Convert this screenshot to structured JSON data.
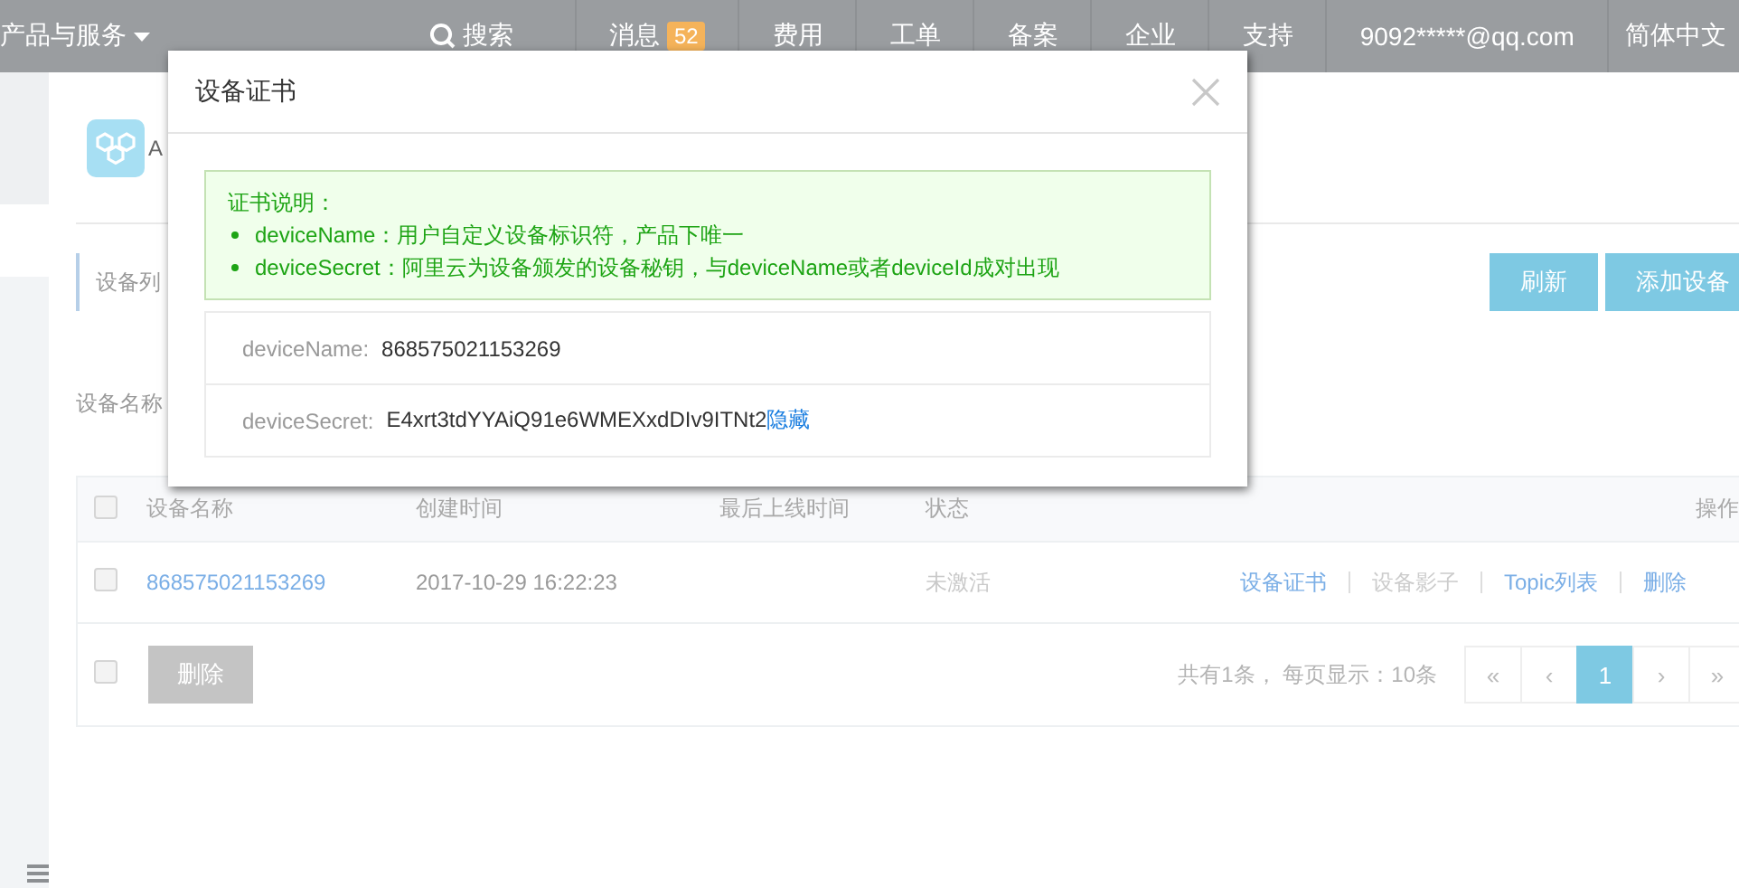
{
  "top_bar": {
    "menu": "产品与服务",
    "items": [
      {
        "kind": "search",
        "label": "搜索"
      },
      {
        "kind": "badge",
        "label": "消息",
        "badge": "52"
      },
      {
        "kind": "link",
        "label": "费用"
      },
      {
        "kind": "link",
        "label": "工单"
      },
      {
        "kind": "link",
        "label": "备案"
      },
      {
        "kind": "link",
        "label": "企业"
      },
      {
        "kind": "link",
        "label": "支持"
      },
      {
        "kind": "link",
        "label": "9092*****@qq.com"
      },
      {
        "kind": "link",
        "label": "简体中文"
      }
    ]
  },
  "product": {
    "name": "A"
  },
  "tabs": [
    {
      "label": "设备列",
      "selected": true
    }
  ],
  "buttons": [
    "刷新",
    "添加设备"
  ],
  "filter": {
    "label": "设备名称"
  },
  "table": {
    "select_all": {
      "checked": false
    },
    "columns": [
      "设备名称",
      "创建时间",
      "最后上线时间",
      "状态",
      "操作"
    ],
    "rows": [
      {
        "checked": false,
        "name": "868575021153269",
        "created": "2017-10-29 16:22:23",
        "status": "未激活",
        "actions": [
          {
            "label": "设备证书",
            "disabled": false
          },
          {
            "label": "设备影子",
            "disabled": true
          },
          {
            "label": "Topic列表",
            "disabled": false
          },
          {
            "label": "删除",
            "disabled": false
          }
        ]
      }
    ],
    "footer": {
      "checked": false,
      "delete_button": {
        "label": "删除",
        "disabled": true
      }
    }
  },
  "pagination": {
    "summary": "共有1条， 每页显示：10条",
    "pages": [
      {
        "label": "«",
        "selected": false
      },
      {
        "label": "‹",
        "selected": false
      },
      {
        "label": "1",
        "selected": true
      },
      {
        "label": "›",
        "selected": false
      },
      {
        "label": "»",
        "selected": false
      }
    ]
  },
  "dialog": {
    "title": "设备证书",
    "notice": {
      "title": "证书说明：",
      "items": [
        "deviceName：用户自定义设备标识符，产品下唯一",
        "deviceSecret：阿里云为设备颁发的设备秘钥，与deviceName或者deviceId成对出现"
      ]
    },
    "fields": [
      {
        "label": "deviceName:",
        "value": "868575021153269"
      },
      {
        "label": "deviceSecret:",
        "value": "E4xrt3tdYYAiQ91e6WMEXxdDIv9ITNt2",
        "link": "隐藏"
      }
    ]
  }
}
